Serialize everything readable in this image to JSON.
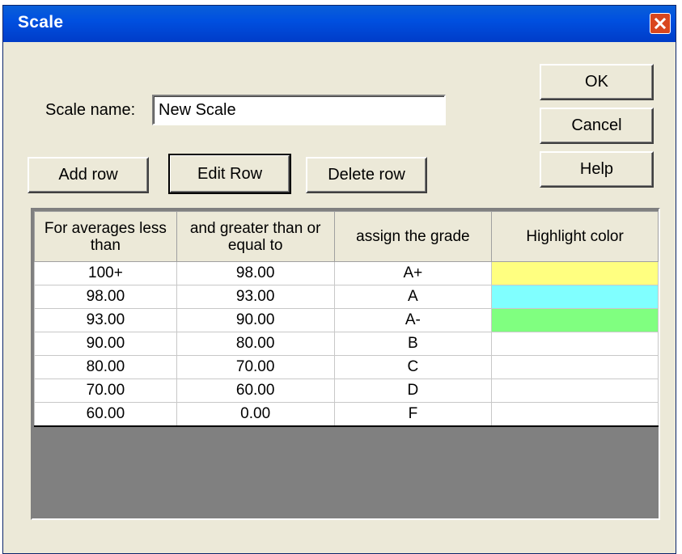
{
  "window": {
    "title": "Scale"
  },
  "scale_name": {
    "label": "Scale name:",
    "value": "New Scale"
  },
  "buttons": {
    "ok": "OK",
    "cancel": "Cancel",
    "help": "Help",
    "add_row": "Add row",
    "edit_row": "Edit Row",
    "delete_row": "Delete row"
  },
  "table": {
    "headers": [
      "For averages less than",
      "and greater than or equal to",
      "assign the grade",
      "Highlight color"
    ],
    "rows": [
      {
        "less_than": "100+",
        "greater_equal": "98.00",
        "grade": "A+",
        "color": "#ffff80"
      },
      {
        "less_than": "98.00",
        "greater_equal": "93.00",
        "grade": "A",
        "color": "#80ffff"
      },
      {
        "less_than": "93.00",
        "greater_equal": "90.00",
        "grade": "A-",
        "color": "#80ff80"
      },
      {
        "less_than": "90.00",
        "greater_equal": "80.00",
        "grade": "B",
        "color": "#ffffff"
      },
      {
        "less_than": "80.00",
        "greater_equal": "70.00",
        "grade": "C",
        "color": "#ffffff"
      },
      {
        "less_than": "70.00",
        "greater_equal": "60.00",
        "grade": "D",
        "color": "#ffffff"
      },
      {
        "less_than": "60.00",
        "greater_equal": "0.00",
        "grade": "F",
        "color": "#ffffff"
      }
    ]
  },
  "icons": {
    "close": "close-icon"
  }
}
